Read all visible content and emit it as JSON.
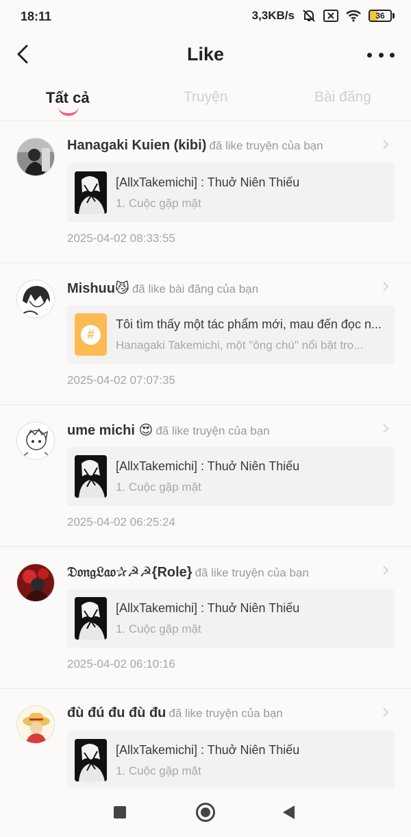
{
  "status_bar": {
    "time": "18:11",
    "net_speed": "3,3KB/s",
    "battery": "36",
    "battery_level": 0.36
  },
  "header": {
    "title": "Like"
  },
  "tabs": [
    {
      "label": "Tất cả",
      "active": true
    },
    {
      "label": "Truyện",
      "active": false
    },
    {
      "label": "Bài đăng",
      "active": false
    }
  ],
  "items": [
    {
      "user": "Hanagaki Kuien (kibi)",
      "action": "đã like truyện của bạn",
      "card_type": "story",
      "card_title": "[AllxTakemichi] : Thuở Niên Thiếu",
      "card_sub": "1. Cuộc gặp mặt",
      "time": "2025-04-02 08:33:55"
    },
    {
      "user": "Mishuu😼",
      "action": "đã like bài đăng của bạn",
      "card_type": "post",
      "card_title": "Tôi tìm thấy một tác phẩm mới, mau đến đọc n...",
      "card_sub": "Hanagaki Takemichi, một \"ông chú\" nổi bật tro...",
      "time": "2025-04-02 07:07:35"
    },
    {
      "user": "ume michi 😍",
      "action": "đã like truyện của bạn",
      "card_type": "story",
      "card_title": "[AllxTakemichi] : Thuở Niên Thiếu",
      "card_sub": "1. Cuộc gặp mặt",
      "time": "2025-04-02 06:25:24"
    },
    {
      "user": "𝔇𝔬𝔫𝔤𝔏𝔞𝔬✰☭☭{Role}",
      "action": "đã like truyện của bạn",
      "card_type": "story",
      "card_title": "[AllxTakemichi] : Thuở Niên Thiếu",
      "card_sub": "1. Cuộc gặp mặt",
      "time": "2025-04-02 06:10:16"
    },
    {
      "user": "đù đú đu đù đu",
      "action": "đã like truyện của bạn",
      "card_type": "story",
      "card_title": "[AllxTakemichi] : Thuở Niên Thiếu",
      "card_sub": "1. Cuộc gặp mặt",
      "time": ""
    }
  ],
  "colors": {
    "accent": "#f25f7e",
    "hashtag": "#fbbb52",
    "battery": "#f3c443"
  }
}
